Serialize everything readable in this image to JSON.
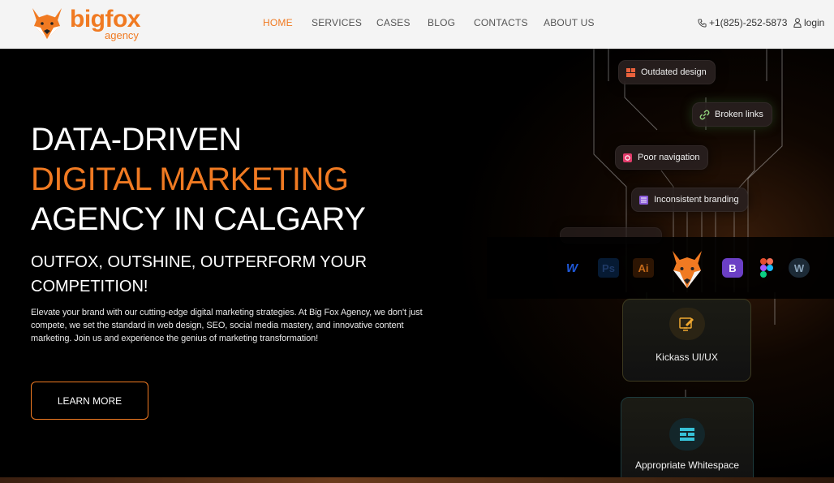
{
  "brand": {
    "name": "bigfox",
    "tagline": "agency",
    "accent_color": "#f07a22"
  },
  "nav": {
    "items": [
      {
        "label": "HOME",
        "active": true
      },
      {
        "label": "SERVICES",
        "active": false
      },
      {
        "label": "CASES",
        "active": false
      },
      {
        "label": "BLOG",
        "active": false
      },
      {
        "label": "CONTACTS",
        "active": false
      },
      {
        "label": "ABOUT US",
        "active": false
      }
    ]
  },
  "header": {
    "phone": "+1(825)-252-5873",
    "phone_icon": "phone-icon",
    "login": "login",
    "login_icon": "user-icon"
  },
  "hero": {
    "title_line1": "DATA-DRIVEN",
    "title_line2": "DIGITAL MARKETING",
    "title_line3": "AGENCY IN CALGARY",
    "subtitle_line1": "OUTFOX, OUTSHINE, OUTPERFORM YOUR",
    "subtitle_line2": "COMPETITION!",
    "description": "Elevate your brand with our cutting-edge digital marketing strategies. At Big Fox Agency, we don't just compete, we set the standard in web design, SEO, social media mastery, and innovative content marketing. Join us and experience the genius of marketing transformation!",
    "cta": "LEARN MORE"
  },
  "problems": [
    {
      "label": "Outdated design",
      "icon": "layout-icon"
    },
    {
      "label": "Broken links",
      "icon": "link-icon"
    },
    {
      "label": "Poor navigation",
      "icon": "navigation-icon"
    },
    {
      "label": "Inconsistent branding",
      "icon": "branding-icon"
    }
  ],
  "tools": [
    {
      "name": "Webflow",
      "icon": "webflow-icon",
      "text": "W"
    },
    {
      "name": "Photoshop",
      "icon": "photoshop-icon",
      "text": "Ps"
    },
    {
      "name": "Illustrator",
      "icon": "illustrator-icon",
      "text": "Ai"
    },
    {
      "name": "Bootstrap",
      "icon": "bootstrap-icon",
      "text": "B"
    },
    {
      "name": "Figma",
      "icon": "figma-icon",
      "text": ""
    },
    {
      "name": "WordPress",
      "icon": "wordpress-icon",
      "text": "W"
    }
  ],
  "solutions": [
    {
      "label": "Kickass UI/UX",
      "icon": "pen-tablet-icon"
    },
    {
      "label": "Appropriate Whitespace",
      "icon": "layout-grid-icon"
    }
  ]
}
